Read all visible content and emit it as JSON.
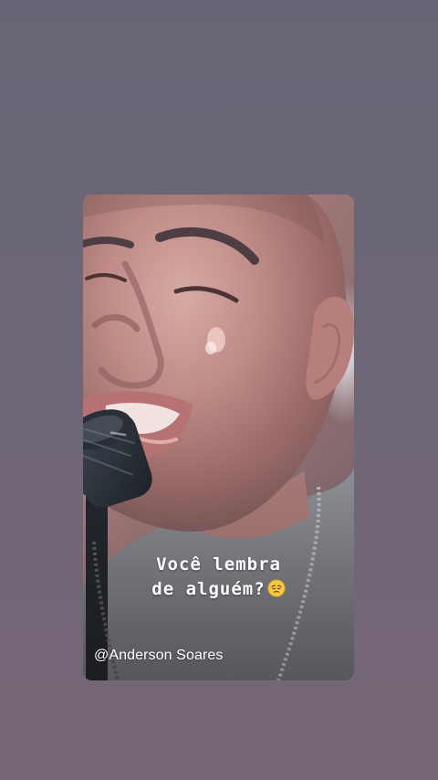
{
  "screen": {
    "background_top": "#676575",
    "background_bottom": "#776675"
  },
  "story": {
    "caption_line_1": "Você lembra",
    "caption_line_2": "de alguém?",
    "emoji_icon": "pensive-face-emoji",
    "author_tag": "@Anderson Soares"
  }
}
